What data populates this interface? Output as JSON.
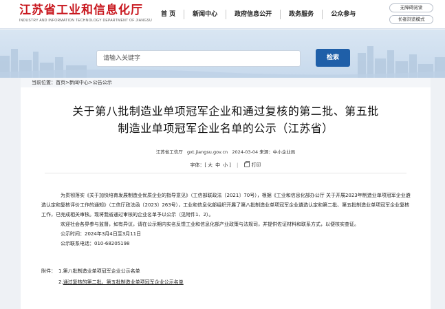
{
  "header": {
    "logo_title": "江苏省工业和信息化厅",
    "logo_sub": "INDUSTRY AND INFORMATION TECHNOLOGY DEPARTMENT OF JIANGSU",
    "nav": [
      "首 页",
      "新闻中心",
      "政府信息公开",
      "政务服务",
      "公众参与"
    ],
    "mode_buttons": [
      "无障碍阅读",
      "长者浏览模式"
    ]
  },
  "search": {
    "placeholder": "请输入关键字",
    "button": "检索"
  },
  "breadcrumb": [
    "当前位置：",
    "首页",
    "新闻中心",
    "公告公示"
  ],
  "article": {
    "title_line1": "关于第八批制造业单项冠军企业和通过复核的第二批、第五批",
    "title_line2": "制造业单项冠军企业名单的公示（江苏省）",
    "source": "江苏省工信厅",
    "url": "gxt.jiangsu.gov.cn",
    "date": "2024-03-04",
    "origin": "来源：中小企业局",
    "font_label": "字体：",
    "font_big": "大",
    "font_mid": "中",
    "font_small": "小",
    "print": "打印",
    "para1": "为贯彻落实《关于加快培育发展制造业优质企业的指导意见》（工信部联政法〔2021〕70号），根据《工业和信息化部办公厅 关于开展2023年制造业单项冠军企业遴选认定和复核评价工作的通知》（工信厅政法函〔2023〕263号），工业和信息化部组织开展了第八批制造业单项冠军企业遴选认定和第二批、第五批制造业单项冠军企业复核工作，已完成相关审核。现将我省通过审核的企业名单予以公示（见附件1、2）。",
    "para2": "欢迎社会各界参与监督，如有异议，请在公示期内实名反馈工业和信息化部产业政策与法规司，并提供佐证材料和联系方式，以便核实查证。",
    "period": "公示时间：2024年3月4日至3月11日",
    "phone": "公示联系电话：010-68205198",
    "attach_label": "附件：",
    "attach1": "1.第八批制造业单项冠军企业公示名单",
    "attach2_num": "2.",
    "attach2": "通过复核的第二批、第五批制造业单项冠军企业公示名单"
  },
  "colors": {
    "brand_red": "#c8161d",
    "search_blue": "#1f5fa8",
    "band_bg": "#c7d9ec"
  }
}
